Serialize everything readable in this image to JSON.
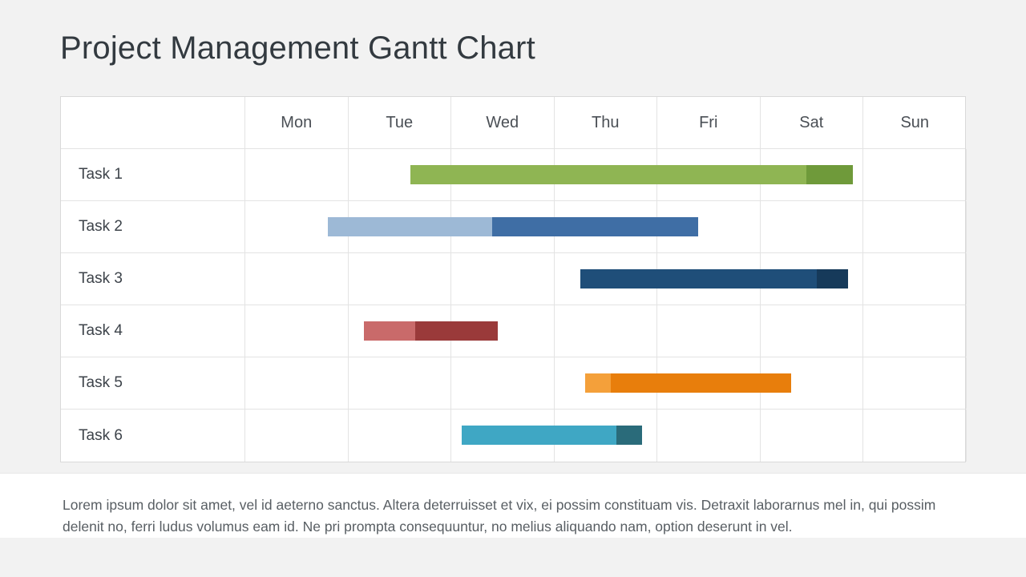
{
  "title": "Project Management Gantt Chart",
  "days": [
    "Mon",
    "Tue",
    "Wed",
    "Thu",
    "Fri",
    "Sat",
    "Sun"
  ],
  "colors": {
    "task1_light": "#8fb553",
    "task1_dark": "#6f9a3a",
    "task2_light": "#9db9d6",
    "task2_dark": "#3f6ea5",
    "task3_light": "#1f4e79",
    "task3_dark": "#163a5a",
    "task4_light": "#c96a6a",
    "task4_dark": "#9a3a3a",
    "task5_light": "#f4a03a",
    "task5_dark": "#e87e0c",
    "task6_light": "#3fa7c4",
    "task6_dark": "#2a6b7a"
  },
  "chart_data": {
    "type": "bar",
    "title": "Project Management Gantt Chart",
    "categories": [
      "Mon",
      "Tue",
      "Wed",
      "Thu",
      "Fri",
      "Sat",
      "Sun"
    ],
    "xlabel": "",
    "ylabel": "",
    "series": [
      {
        "name": "Task 1",
        "start": 1.6,
        "end": 5.9,
        "split": 5.45,
        "color_a": "#8fb553",
        "color_b": "#6f9a3a"
      },
      {
        "name": "Task 2",
        "start": 0.8,
        "end": 4.4,
        "split": 2.4,
        "color_a": "#9db9d6",
        "color_b": "#3f6ea5"
      },
      {
        "name": "Task 3",
        "start": 3.25,
        "end": 5.85,
        "split": 5.55,
        "color_a": "#1f4e79",
        "color_b": "#163a5a"
      },
      {
        "name": "Task 4",
        "start": 1.15,
        "end": 2.45,
        "split": 1.65,
        "color_a": "#c96a6a",
        "color_b": "#9a3a3a"
      },
      {
        "name": "Task 5",
        "start": 3.3,
        "end": 5.3,
        "split": 3.55,
        "color_a": "#f4a03a",
        "color_b": "#e87e0c"
      },
      {
        "name": "Task 6",
        "start": 2.1,
        "end": 3.85,
        "split": 3.6,
        "color_a": "#3fa7c4",
        "color_b": "#2a6b7a"
      }
    ]
  },
  "footer": "Lorem ipsum dolor sit amet, vel id aeterno sanctus. Altera deterruisset et vix, ei possim constituam vis. Detraxit laborarnus mel in, qui possim delenit no, ferri ludus volumus eam id. Ne pri prompta consequuntur, no melius aliquando nam, option deserunt in vel."
}
